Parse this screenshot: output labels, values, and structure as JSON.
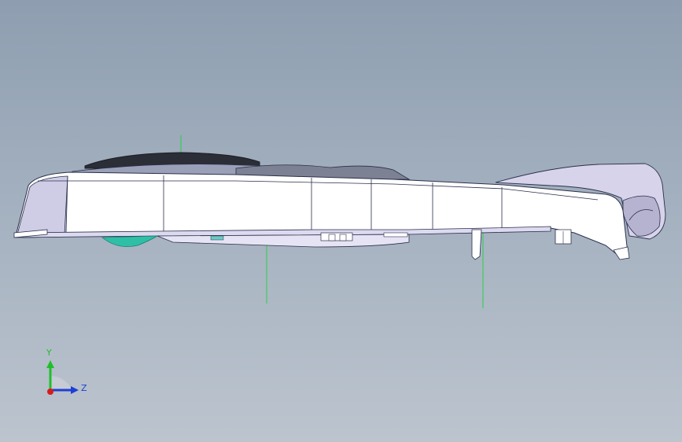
{
  "triad": {
    "y_label": "Y",
    "z_label": "Z",
    "colors": {
      "y_axis": "#1fbf2a",
      "z_axis": "#1d3fd6",
      "x_axis": "#d81b1b"
    }
  },
  "model": {
    "body_color": "#ffffff",
    "edge_color": "#2a2f4a",
    "dark_top_color": "#2a2d35",
    "accent_color": "#2fbfa7",
    "centerline_color": "#27d04a"
  }
}
